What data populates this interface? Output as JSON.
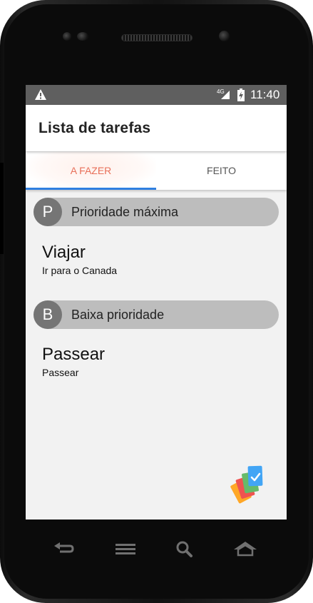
{
  "status_bar": {
    "network_type": "4G",
    "time": "11:40"
  },
  "app": {
    "title": "Lista de tarefas"
  },
  "tabs": [
    {
      "label": "A FAZER",
      "active": true
    },
    {
      "label": "FEITO",
      "active": false
    }
  ],
  "sections": [
    {
      "badge": "P",
      "label": "Prioridade máxima",
      "tasks": [
        {
          "title": "Viajar",
          "description": "Ir para o Canada"
        }
      ]
    },
    {
      "badge": "B",
      "label": "Baixa prioridade",
      "tasks": [
        {
          "title": "Passear",
          "description": "Passear"
        }
      ]
    }
  ],
  "colors": {
    "accent_tab_text": "#e8705a",
    "tab_indicator": "#2f7fe0",
    "section_header_bg": "#bdbdbd",
    "section_badge_bg": "#757575",
    "screen_bg": "#f2f2f2",
    "status_bar_bg": "#5f5f5f",
    "logo_check_blue": "#42a5f5"
  },
  "icons": {
    "status": [
      "warning-icon",
      "signal-icon",
      "battery-icon"
    ],
    "fab": "task-cards-logo-icon",
    "navigation": [
      "back-icon",
      "menu-icon",
      "search-icon",
      "home-icon"
    ]
  }
}
